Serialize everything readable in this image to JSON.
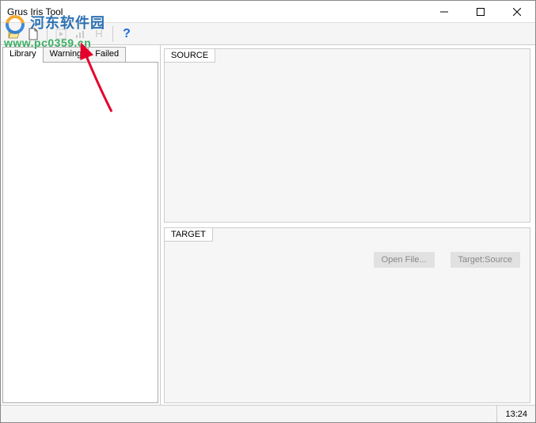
{
  "window": {
    "title": "Grus Iris Tool"
  },
  "toolbar": {
    "icons": {
      "open": "folder-open-icon",
      "new": "new-file-icon",
      "play": "play-icon",
      "chart": "chart-icon",
      "h": "H",
      "help": "?"
    }
  },
  "tabs": {
    "library": "Library",
    "warning": "Warning",
    "failed": "Failed"
  },
  "panels": {
    "source": "SOURCE",
    "target": "TARGET"
  },
  "buttons": {
    "open_file": "Open File...",
    "target_source": "Target:Source"
  },
  "status": {
    "time": "13:24"
  },
  "watermark": {
    "site_name": "河东软件园",
    "url": "www.pc0359.cn"
  }
}
